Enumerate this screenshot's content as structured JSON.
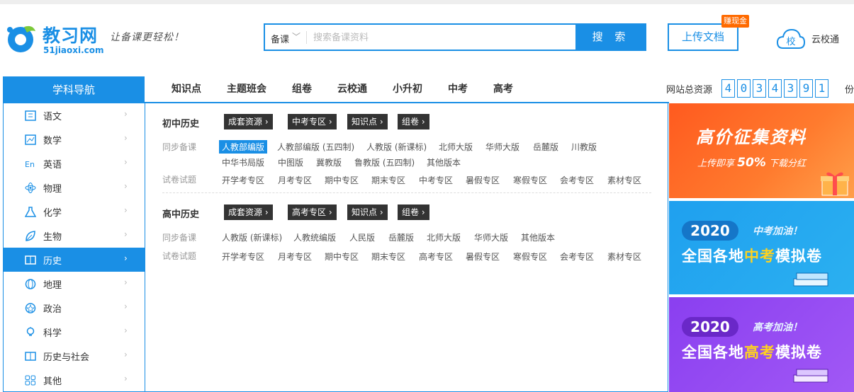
{
  "brand": {
    "name": "教习网",
    "domain": "51jiaoxi.com",
    "slogan": "让备课更轻松！"
  },
  "search": {
    "category": "备课",
    "placeholder": "搜索备课资料",
    "button": "搜 索"
  },
  "header": {
    "upload": "上传文档",
    "badge": "赚现金",
    "yunxiaotong": "云校通"
  },
  "nav": {
    "title": "学科导航",
    "items": [
      "知识点",
      "主题班会",
      "组卷",
      "云校通",
      "小升初",
      "中考",
      "高考"
    ]
  },
  "stats": {
    "label": "网站总资源",
    "digits": [
      "4",
      "0",
      "3",
      "4",
      "3",
      "9",
      "1"
    ],
    "unit": "份"
  },
  "sidebar": {
    "items": [
      {
        "label": "语文",
        "icon": "book-icon",
        "arrow": "›"
      },
      {
        "label": "数学",
        "icon": "chart-icon",
        "arrow": "›"
      },
      {
        "label": "英语",
        "icon": "english-icon",
        "arrow": "›"
      },
      {
        "label": "物理",
        "icon": "atom-icon",
        "arrow": "›"
      },
      {
        "label": "化学",
        "icon": "flask-icon",
        "arrow": "›"
      },
      {
        "label": "生物",
        "icon": "leaf-icon",
        "arrow": "›"
      },
      {
        "label": "历史",
        "icon": "history-book-icon",
        "arrow": "›",
        "active": true
      },
      {
        "label": "地理",
        "icon": "globe-icon",
        "arrow": "›"
      },
      {
        "label": "政治",
        "icon": "politics-icon",
        "arrow": "›"
      },
      {
        "label": "科学",
        "icon": "bulb-icon",
        "arrow": "›"
      },
      {
        "label": "历史与社会",
        "icon": "society-book-icon",
        "arrow": "›"
      },
      {
        "label": "其他",
        "icon": "grid-icon",
        "arrow": "›"
      }
    ]
  },
  "sections": [
    {
      "title": "初中历史",
      "tags": [
        "成套资源 ›",
        "中考专区 ›",
        "知识点 ›",
        "组卷 ›"
      ],
      "sync_label": "同步备课",
      "sync_items": [
        "人教部编版",
        "人教部编版 (五四制)",
        "人教版 (新课标)",
        "北师大版",
        "华师大版",
        "岳麓版",
        "川教版",
        "中华书局版",
        "中图版",
        "冀教版",
        "鲁教版 (五四制)",
        "其他版本"
      ],
      "exam_label": "试卷试题",
      "exam_items": [
        "开学考专区",
        "月考专区",
        "期中专区",
        "期末专区",
        "中考专区",
        "暑假专区",
        "寒假专区",
        "会考专区",
        "素材专区"
      ]
    },
    {
      "title": "高中历史",
      "tags": [
        "成套资源 ›",
        "高考专区 ›",
        "知识点 ›",
        "组卷 ›"
      ],
      "sync_label": "同步备课",
      "sync_items": [
        "人教版 (新课标)",
        "人教统编版",
        "人民版",
        "岳麓版",
        "北师大版",
        "华师大版",
        "其他版本"
      ],
      "exam_label": "试卷试题",
      "exam_items": [
        "开学考专区",
        "月考专区",
        "期中专区",
        "期末专区",
        "高考专区",
        "暑假专区",
        "寒假专区",
        "会考专区",
        "素材专区"
      ]
    }
  ],
  "banners": {
    "b1": {
      "title": "高价征集资料",
      "sub_pre": "上传即享",
      "sub_pct": "50%",
      "sub_post": "下载分红"
    },
    "b2": {
      "year": "2020",
      "slogan": "中考加油！",
      "pre": "全国各地",
      "hl": "中考",
      "post": "模拟卷"
    },
    "b3": {
      "year": "2020",
      "slogan": "高考加油！",
      "pre": "全国各地",
      "hl": "高考",
      "post": "模拟卷"
    }
  },
  "colors": {
    "accent": "#1a8fe5",
    "badge": "#ff6a00",
    "tag_bg": "#333333",
    "banner_orange": "#ff6a28",
    "banner_blue": "#22a8ef",
    "banner_purple": "#9450f2",
    "highlight_yellow": "#ffd21f"
  }
}
